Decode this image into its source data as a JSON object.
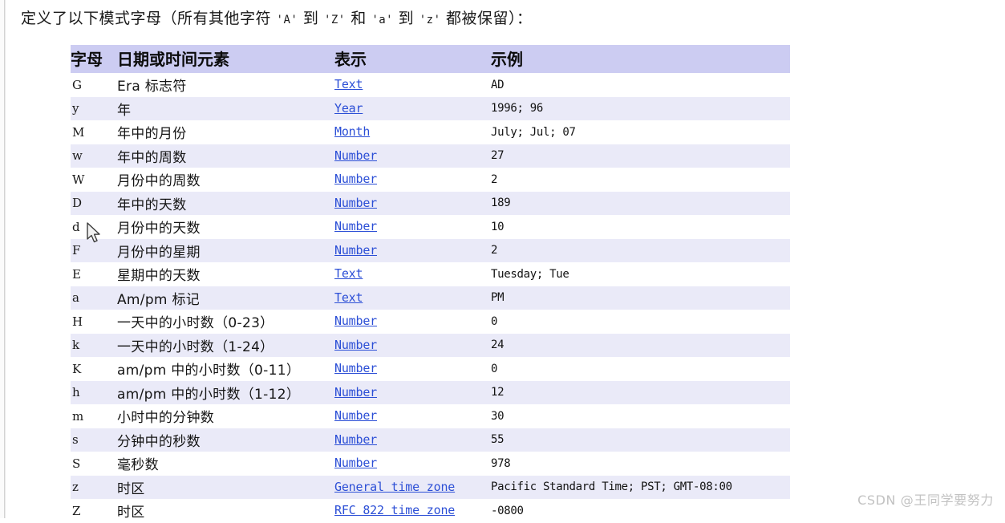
{
  "intro": {
    "prefix": "定义了以下模式字母（所有其他字符 ",
    "lit1": "'A'",
    "mid1": " 到 ",
    "lit2": "'Z'",
    "mid2": " 和 ",
    "lit3": "'a'",
    "mid3": " 到 ",
    "lit4": "'z'",
    "suffix": " 都被保留）："
  },
  "table": {
    "headers": {
      "letter": "字母",
      "element": "日期或时间元素",
      "presentation": "表示",
      "example": "示例"
    },
    "rows": [
      {
        "letter": "G",
        "element": "Era 标志符",
        "presentation": "Text",
        "example": "AD"
      },
      {
        "letter": "y",
        "element": "年",
        "presentation": "Year",
        "example": "1996; 96"
      },
      {
        "letter": "M",
        "element": "年中的月份",
        "presentation": "Month",
        "example": "July; Jul; 07"
      },
      {
        "letter": "w",
        "element": "年中的周数",
        "presentation": "Number",
        "example": "27"
      },
      {
        "letter": "W",
        "element": "月份中的周数",
        "presentation": "Number",
        "example": "2"
      },
      {
        "letter": "D",
        "element": "年中的天数",
        "presentation": "Number",
        "example": "189"
      },
      {
        "letter": "d",
        "element": "月份中的天数",
        "presentation": "Number",
        "example": "10"
      },
      {
        "letter": "F",
        "element": "月份中的星期",
        "presentation": "Number",
        "example": "2"
      },
      {
        "letter": "E",
        "element": "星期中的天数",
        "presentation": "Text",
        "example": "Tuesday; Tue"
      },
      {
        "letter": "a",
        "element": "Am/pm 标记",
        "presentation": "Text",
        "example": "PM"
      },
      {
        "letter": "H",
        "element": "一天中的小时数（0-23）",
        "presentation": "Number",
        "example": "0"
      },
      {
        "letter": "k",
        "element": "一天中的小时数（1-24）",
        "presentation": "Number",
        "example": "24"
      },
      {
        "letter": "K",
        "element": "am/pm 中的小时数（0-11）",
        "presentation": "Number",
        "example": "0"
      },
      {
        "letter": "h",
        "element": "am/pm 中的小时数（1-12）",
        "presentation": "Number",
        "example": "12"
      },
      {
        "letter": "m",
        "element": "小时中的分钟数",
        "presentation": "Number",
        "example": "30"
      },
      {
        "letter": "s",
        "element": "分钟中的秒数",
        "presentation": "Number",
        "example": "55"
      },
      {
        "letter": "S",
        "element": "毫秒数",
        "presentation": "Number",
        "example": "978"
      },
      {
        "letter": "z",
        "element": "时区",
        "presentation": "General time zone",
        "example": "Pacific Standard Time; PST; GMT-08:00"
      },
      {
        "letter": "Z",
        "element": "时区",
        "presentation": "RFC 822 time zone",
        "example": "-0800"
      }
    ]
  },
  "watermark": {
    "text": "CSDN @王同学要努力"
  },
  "colors": {
    "header_bg": "#ccccf2",
    "stripe_bg": "#eaeaf8",
    "row_bg": "#ffffff",
    "link": "#2c4fd6",
    "text": "#111111",
    "watermark": "#c2c2c2"
  }
}
